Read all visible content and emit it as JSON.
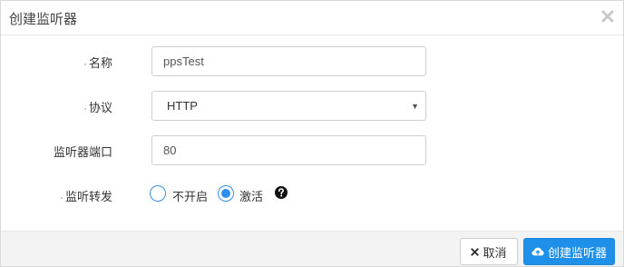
{
  "dialog": {
    "title": "创建监听器"
  },
  "form": {
    "name": {
      "label": "名称",
      "value": "ppsTest"
    },
    "protocol": {
      "label": "协议",
      "value": "HTTP"
    },
    "port": {
      "label": "监听器端口",
      "value": "80"
    },
    "forwarding": {
      "label": "监听转发",
      "options": [
        {
          "label": "不开启",
          "checked": false
        },
        {
          "label": "激活",
          "checked": true
        }
      ]
    }
  },
  "footer": {
    "cancel_label": "取消",
    "create_label": "创建监听器"
  },
  "colors": {
    "primary": "#1e90ea",
    "radio_border": "#3a8ee6",
    "footer_bg": "#f3f3f3"
  }
}
